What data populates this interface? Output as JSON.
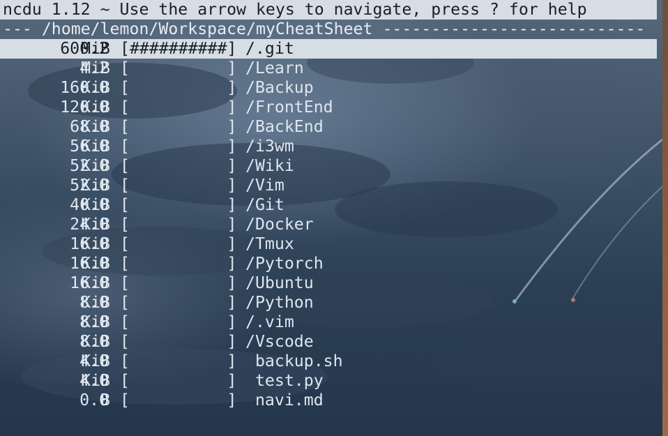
{
  "header": {
    "title": "ncdu 1.12 ~ Use the arrow keys to navigate, press ? for help",
    "path_line": "--- /home/lemon/Workspace/myCheatSheet ---------------------------"
  },
  "entries": [
    {
      "size": "600.2",
      "unit": "MiB",
      "bar": "[##########]",
      "name": "/.git",
      "selected": true
    },
    {
      "size": "4.2",
      "unit": "MiB",
      "bar": "[          ]",
      "name": "/Learn"
    },
    {
      "size": "160.0",
      "unit": "KiB",
      "bar": "[          ]",
      "name": "/Backup"
    },
    {
      "size": "120.0",
      "unit": "KiB",
      "bar": "[          ]",
      "name": "/FrontEnd"
    },
    {
      "size": "68.0",
      "unit": "KiB",
      "bar": "[          ]",
      "name": "/BackEnd"
    },
    {
      "size": "56.0",
      "unit": "KiB",
      "bar": "[          ]",
      "name": "/i3wm"
    },
    {
      "size": "52.0",
      "unit": "KiB",
      "bar": "[          ]",
      "name": "/Wiki"
    },
    {
      "size": "52.0",
      "unit": "KiB",
      "bar": "[          ]",
      "name": "/Vim"
    },
    {
      "size": "40.0",
      "unit": "KiB",
      "bar": "[          ]",
      "name": "/Git"
    },
    {
      "size": "24.0",
      "unit": "KiB",
      "bar": "[          ]",
      "name": "/Docker"
    },
    {
      "size": "16.0",
      "unit": "KiB",
      "bar": "[          ]",
      "name": "/Tmux"
    },
    {
      "size": "16.0",
      "unit": "KiB",
      "bar": "[          ]",
      "name": "/Pytorch"
    },
    {
      "size": "16.0",
      "unit": "KiB",
      "bar": "[          ]",
      "name": "/Ubuntu"
    },
    {
      "size": "8.0",
      "unit": "KiB",
      "bar": "[          ]",
      "name": "/Python"
    },
    {
      "size": "8.0",
      "unit": "KiB",
      "bar": "[          ]",
      "name": "/.vim"
    },
    {
      "size": "8.0",
      "unit": "KiB",
      "bar": "[          ]",
      "name": "/Vscode"
    },
    {
      "size": "4.0",
      "unit": "KiB",
      "bar": "[          ]",
      "name": " backup.sh"
    },
    {
      "size": "4.0",
      "unit": "KiB",
      "bar": "[          ]",
      "name": " test.py"
    },
    {
      "size": "0.0",
      "unit": "B",
      "bar": "[          ]",
      "name": " navi.md"
    }
  ]
}
